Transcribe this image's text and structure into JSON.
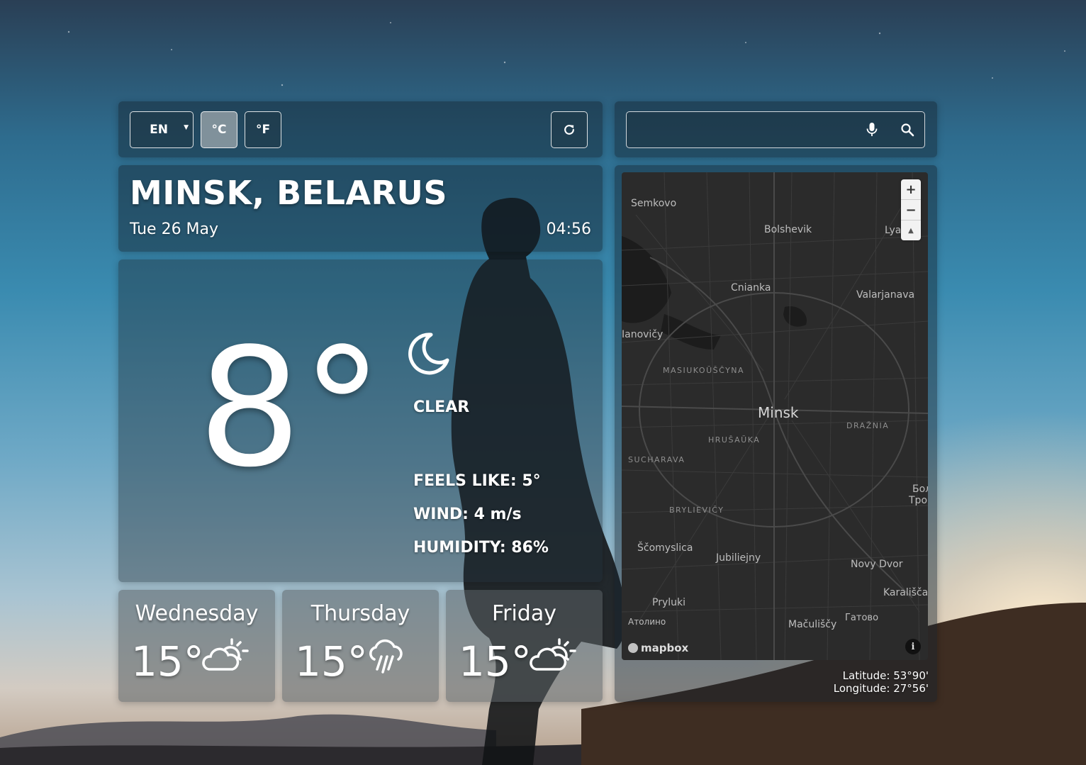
{
  "toolbar": {
    "language": "EN",
    "celsius_label": "°C",
    "fahrenheit_label": "°F",
    "refresh_icon": "refresh-icon",
    "active_unit": "celsius"
  },
  "search": {
    "value": "",
    "mic_icon": "microphone-icon",
    "search_icon": "search-icon"
  },
  "location": {
    "city": "MINSK, BELARUS",
    "date": "Tue 26 May",
    "time": "04:56"
  },
  "current": {
    "temperature": "8°",
    "icon": "crescent-moon-icon",
    "condition": "CLEAR",
    "feels_like": "FEELS LIKE: 5°",
    "wind": "WIND: 4 m/s",
    "humidity": "HUMIDITY: 86%"
  },
  "forecast": [
    {
      "day": "Wednesday",
      "temp": "15°",
      "icon": "partly-cloudy-sun-icon"
    },
    {
      "day": "Thursday",
      "temp": "15°",
      "icon": "rain-cloud-icon"
    },
    {
      "day": "Friday",
      "temp": "15°",
      "icon": "partly-cloudy-sun-icon"
    }
  ],
  "map": {
    "labels": {
      "semkovo": "Semkovo",
      "bolshevik": "Bolshevik",
      "lya": "Lya",
      "cnianka": "Cnianka",
      "valarjanava": "Valarjanava",
      "janovicy": "Ianovičy",
      "masiukouscyna": "MASIUKOŬŠČYNA",
      "minsk": "Minsk",
      "draznia": "DRAŽNIA",
      "hrusauka": "HRUŠAŬKA",
      "sucharava": "SUCHARAVA",
      "bol": "Бол",
      "troc": "Троц",
      "brylievicy": "BRYLIEVIČY",
      "scomyslica": "Ščomyslica",
      "jubiliejny": "Jubiliejny",
      "novy_dvor": "Novy Dvor",
      "karaliscavi": "Karališčavi",
      "pryluki": "Pryluki",
      "atolino": "Атолино",
      "maculiscy": "Mačuliščy",
      "gatovo": "Гатово"
    },
    "attribution": "mapbox",
    "zoom_in": "+",
    "zoom_out": "−",
    "compass": "▲",
    "latitude": "Latitude: 53°90'",
    "longitude": "Longitude: 27°56'"
  },
  "colors": {
    "panel_bg": "#14222c",
    "map_bg": "#2b2b2b",
    "active_unit_bg": "#a0aaaf"
  }
}
